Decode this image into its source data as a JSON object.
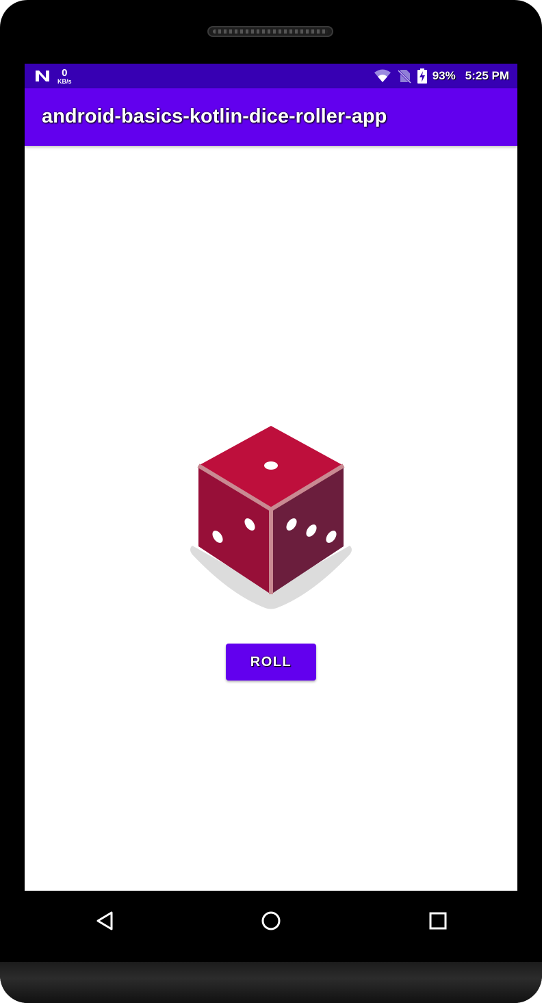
{
  "status_bar": {
    "net_speed_value": "0",
    "net_speed_unit": "KB/s",
    "battery_percent": "93%",
    "time": "5:25 PM",
    "icons": [
      "n-notification-icon",
      "wifi-icon",
      "no-sim-icon",
      "battery-charging-icon"
    ]
  },
  "app_bar": {
    "title": "android-basics-kotlin-dice-roller-app"
  },
  "main": {
    "dice": {
      "icon": "dice-icon",
      "top_face_pips": 1,
      "left_face_pips": 2,
      "right_face_pips": 3
    },
    "roll_button_label": "ROLL"
  },
  "nav_bar": {
    "icons": [
      "back-icon",
      "home-icon",
      "recents-icon"
    ]
  },
  "colors": {
    "status_bar": "#3700b3",
    "app_bar": "#6200ee",
    "button": "#6200ee",
    "dice_top": "#be0f3c",
    "dice_left": "#970f38",
    "dice_right": "#6b1e3d",
    "dice_edge": "#c98a92"
  }
}
